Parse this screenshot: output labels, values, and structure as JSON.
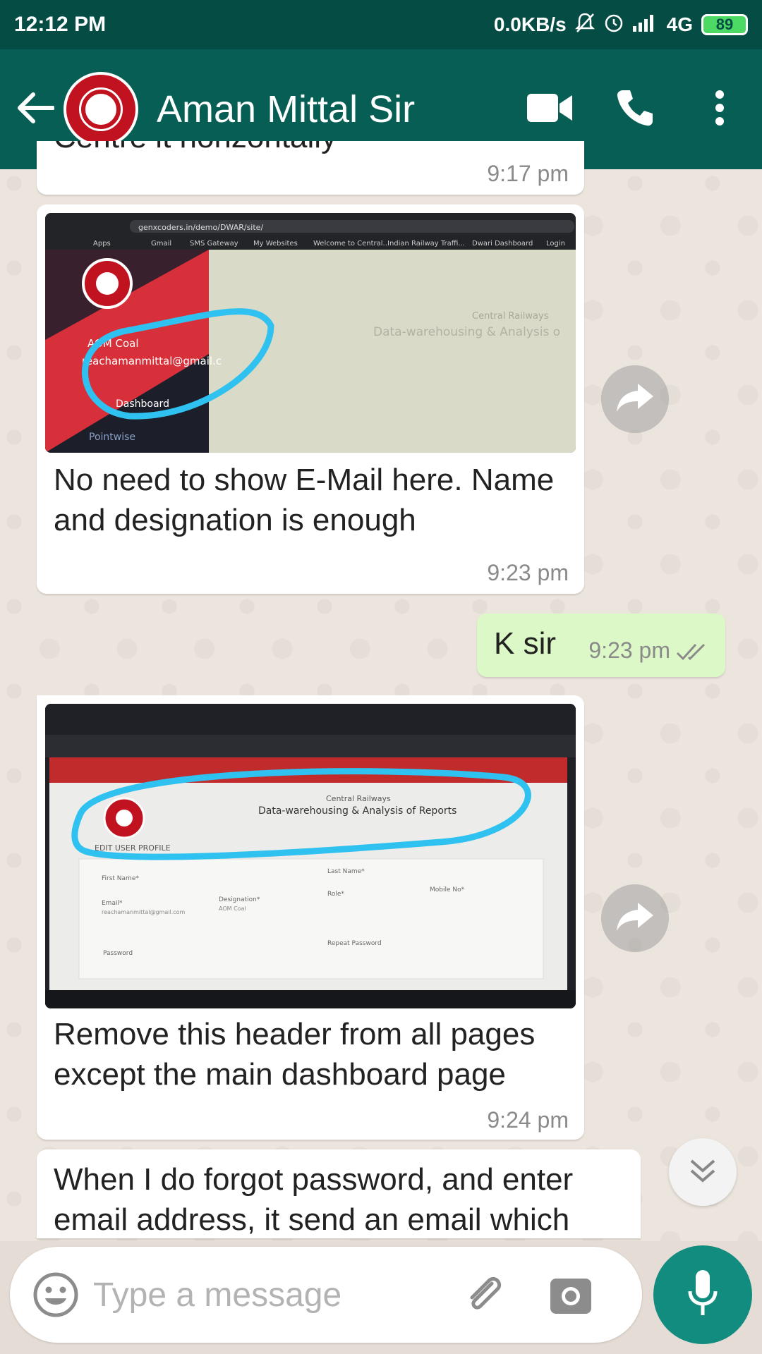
{
  "status_bar": {
    "time": "12:12 PM",
    "network_speed": "0.0KB/s",
    "network_type": "4G",
    "battery": "89",
    "icons": [
      "mute-bell-icon",
      "alarm-icon",
      "signal-icon",
      "battery-icon"
    ]
  },
  "header": {
    "contact_name": "Aman Mittal Sir",
    "icons": [
      "back-arrow-icon",
      "video-call-icon",
      "phone-icon",
      "more-vert-icon"
    ]
  },
  "messages": [
    {
      "direction": "in",
      "text": "Centre it horizontally",
      "time": "9:17 pm"
    },
    {
      "direction": "in",
      "type": "image",
      "image_text": {
        "url": "genxcoders.in/demo/DWAR/site/",
        "bookmarks": [
          "Apps",
          "Gmail",
          "SMS Gateway",
          "My Websites",
          "Welcome to Central...",
          "Indian Railway Traffi...",
          "Dwari Dashboard",
          "Login"
        ],
        "user_role": "AOM Coal",
        "user_email": "reachamanmittal@gmail.c",
        "menu_item": "Dashboard",
        "menu_item_2": "Pointwise",
        "watermark_title": "Central Railways",
        "watermark_subtitle": "Data-warehousing & Analysis o"
      },
      "text": "No need to show E-Mail here. Name and designation is enough",
      "time": "9:23 pm"
    },
    {
      "direction": "out",
      "text": "K sir",
      "time": "9:23 pm",
      "status": "read"
    },
    {
      "direction": "in",
      "type": "image",
      "image_text": {
        "small_title": "Central Railways",
        "title": "Data-warehousing & Analysis of Reports",
        "section": "EDIT USER PROFILE",
        "fields": [
          "First Name*",
          "Last Name*",
          "Email*",
          "Designation*",
          "Role*",
          "Mobile No*",
          "Password",
          "Repeat Password"
        ],
        "email_value": "reachamanmittal@gmail.com",
        "designation_value": "AOM Coal"
      },
      "text": "Remove this header from all pages except the main dashboard page",
      "time": "9:24 pm"
    },
    {
      "direction": "in",
      "text": "When I do forgot password, and enter email address, it send an email which"
    }
  ],
  "composer": {
    "placeholder": "Type a message",
    "icons": [
      "emoji-icon",
      "attach-icon",
      "camera-icon",
      "mic-icon"
    ]
  },
  "colors": {
    "header": "#075e54",
    "status_bar": "#054d44",
    "outgoing_bubble": "#dcf8c6",
    "fab": "#128c7e",
    "read_ticks": "#4fc3f7"
  }
}
